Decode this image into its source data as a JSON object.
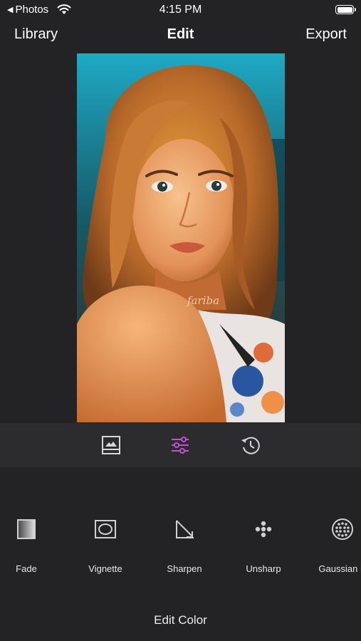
{
  "status": {
    "back_app": "Photos",
    "time": "4:15 PM"
  },
  "nav": {
    "left": "Library",
    "title": "Edit",
    "right": "Export"
  },
  "photo": {
    "watermark": "fariba"
  },
  "toolbar": {
    "icons": [
      "image-icon",
      "sliders-icon",
      "history-icon"
    ],
    "active": "sliders-icon",
    "active_color": "#c44fd9"
  },
  "filters": [
    {
      "label": "Fade",
      "icon": "fade-icon"
    },
    {
      "label": "Vignette",
      "icon": "vignette-icon"
    },
    {
      "label": "Sharpen",
      "icon": "sharpen-icon"
    },
    {
      "label": "Unsharp",
      "icon": "unsharp-icon"
    },
    {
      "label": "Gaussian B",
      "icon": "gaussian-blur-icon"
    }
  ],
  "footer": {
    "title": "Edit Color"
  }
}
